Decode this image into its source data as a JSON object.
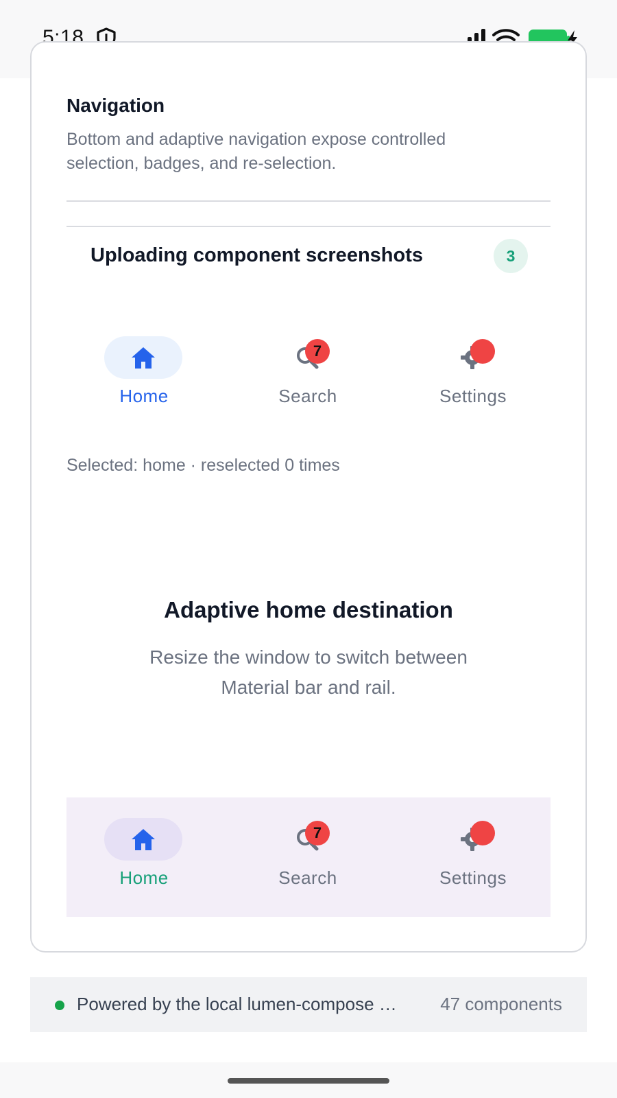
{
  "status_bar": {
    "time": "5:18"
  },
  "section": {
    "title": "Navigation",
    "description": "Bottom and adaptive navigation expose controlled selection, badges, and re-selection."
  },
  "upload": {
    "title": "Uploading component screenshots",
    "count": "3"
  },
  "top_nav": {
    "items": [
      {
        "label": "Home",
        "selected": true,
        "icon": "home-icon"
      },
      {
        "label": "Search",
        "badge": "7",
        "icon": "search-icon"
      },
      {
        "label": "Settings",
        "dot": true,
        "icon": "gear-icon"
      }
    ],
    "selected_color": "#2563eb"
  },
  "selection_text": "Selected: home · reselected 0 times",
  "adaptive": {
    "title": "Adaptive home destination",
    "description": "Resize the window to switch between Material bar and rail."
  },
  "bottom_nav": {
    "items": [
      {
        "label": "Home",
        "selected": true,
        "icon": "home-icon"
      },
      {
        "label": "Search",
        "badge": "7",
        "icon": "search-icon"
      },
      {
        "label": "Settings",
        "dot": true,
        "icon": "gear-icon"
      }
    ],
    "selected_color": "#17a079"
  },
  "footer": {
    "text": "Powered by the local lumen-compose …",
    "count": "47 components"
  }
}
